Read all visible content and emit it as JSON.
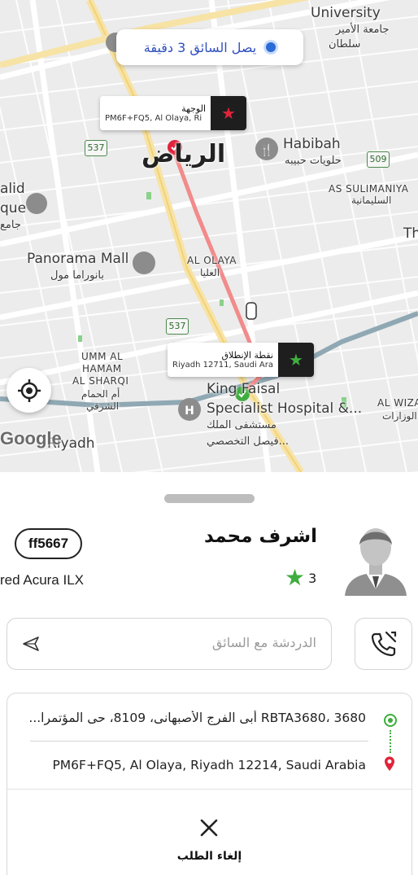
{
  "map": {
    "eta": "يصل السائق 3 دقيقة",
    "labels": {
      "city_ar": "الرياض",
      "university_en": "University",
      "university_ar_1": "جامعة الأمير",
      "university_ar_2": "سلطان",
      "habibah_en": "Habibah",
      "habibah_ar": "حلويات حبيبه",
      "sulimaniya_en": "AS SULIMANIYA",
      "sulimaniya_ar": "السليمانية",
      "panorama_en": "Panorama Mall",
      "panorama_ar": "بانوراما مول",
      "olaya_en": "AL OLAYA",
      "olaya_ar": "العليا",
      "umm_en_1": "UMM AL",
      "umm_en_2": "HAMAM",
      "umm_en_3": "AL SHARQI",
      "umm_ar_1": "أم الحمام",
      "umm_ar_2": "الشرقي",
      "hospital_en_1": "King Faisal",
      "hospital_en_2": "Specialist Hospital &...",
      "hospital_ar_1": "مستشفى الملك",
      "hospital_ar_2": "فيصل التخصصي...",
      "wizarat_en": "AL WIZA",
      "wizarat_ar": "الوزارات",
      "riyadh_en": "Riyadh",
      "alid_1": "alid",
      "alid_2": "que",
      "alid_3": "جامع",
      "th": "Th",
      "google": "Google"
    },
    "shields": {
      "s1": "537",
      "s2": "509",
      "s3": "537"
    },
    "destination_marker": {
      "title": "الوجهة",
      "address": "PM6F+FQ5, Al Olaya, Ri"
    },
    "pickup_marker": {
      "title": "نقطة الإنطلاق",
      "address": "Riyadh 12711, Saudi Arabi"
    }
  },
  "driver": {
    "name": "اشرف محمد",
    "rating": "3",
    "plate": "ff5667",
    "car": "red Acura ILX"
  },
  "chat": {
    "placeholder": "الدردشة مع السائق"
  },
  "trip": {
    "pickup": "3680 ،RBTA3680 أبى الفرج الأصبهانى، 8109، حى المؤتمرا...",
    "dropoff": "PM6F+FQ5, Al Olaya, Riyadh 12214, Saudi Arabia"
  },
  "actions": {
    "cancel_label": "إلغاء الطلب"
  },
  "colors": {
    "route": "#f28b8b",
    "accent_green": "#3fae3f",
    "pin_red": "#e0243b"
  }
}
